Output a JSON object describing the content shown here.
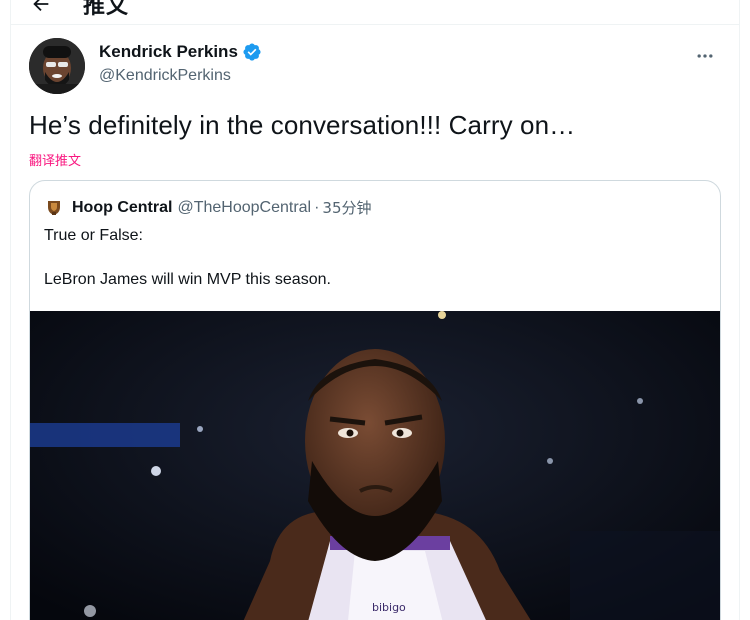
{
  "header": {
    "title": "推文"
  },
  "author": {
    "name": "Kendrick Perkins",
    "handle": "@KendrickPerkins",
    "verified": true
  },
  "tweet": {
    "text": "He’s definitely in the conversation!!! Carry on…",
    "translate_label": "翻译推文"
  },
  "quoted": {
    "name": "Hoop Central",
    "handle": "@TheHoopCentral",
    "separator": "·",
    "time": "35分钟",
    "line1": "True or False:",
    "line2": "LeBron James will win MVP this season."
  },
  "colors": {
    "accent_blue": "#1d9bf0",
    "translate_pink": "#f91880",
    "secondary_text": "#536471",
    "border": "#cfd9de"
  },
  "icons": {
    "back": "arrow-left-icon",
    "verified": "verified-badge-icon",
    "more": "more-horizontal-icon"
  }
}
